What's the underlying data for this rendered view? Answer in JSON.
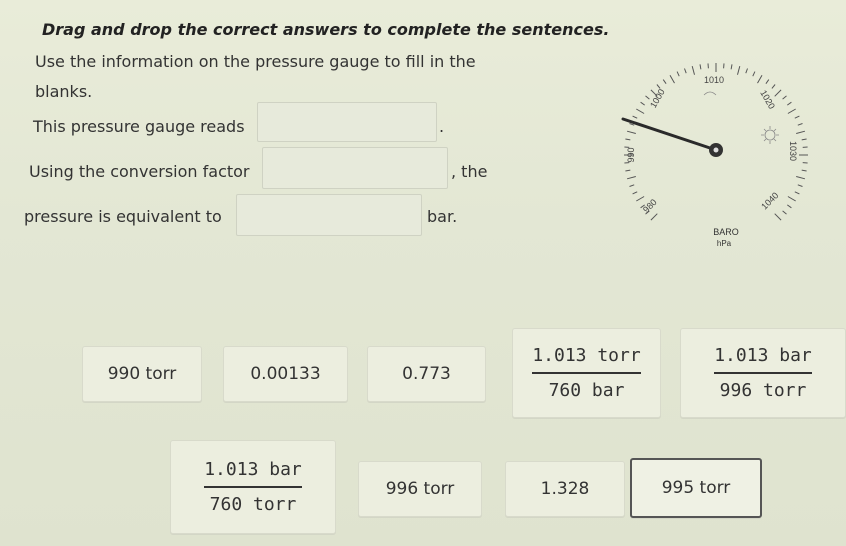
{
  "instructions": "Drag and drop the correct answers to complete the sentences.",
  "prompt_line1": "Use the information on the pressure gauge to fill in the",
  "prompt_line2": "blanks.",
  "sentence1": "This pressure gauge reads",
  "sentence1_end": ".",
  "sentence2": "Using the conversion factor",
  "sentence2_end": ", the",
  "sentence3": "pressure is equivalent to",
  "sentence3_end": "bar.",
  "gauge": {
    "labels": [
      "980",
      "990",
      "1000",
      "1010",
      "1020",
      "1030",
      "1040"
    ],
    "baro": "BARO",
    "unit": "hPa",
    "icon": "sun-icon"
  },
  "options": {
    "o1": "990 torr",
    "o2": "0.00133",
    "o3": "0.773",
    "o4": {
      "num": "1.013 torr",
      "den": "760 bar"
    },
    "o5": {
      "num": "1.013 bar",
      "den": "996 torr"
    },
    "o6": {
      "num": "1.013 bar",
      "den": "760 torr"
    },
    "o7": "996 torr",
    "o8": "1.328",
    "o9": "995 torr"
  }
}
